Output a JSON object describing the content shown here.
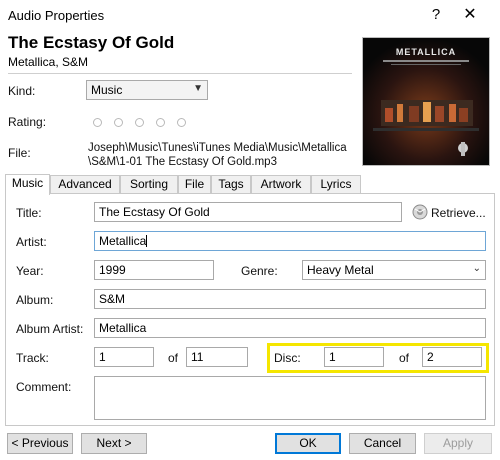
{
  "window": {
    "title": "Audio Properties",
    "help": "?",
    "close": "✕"
  },
  "header": {
    "title": "The Ecstasy Of Gold",
    "subtitle": "Metallica, S&M"
  },
  "artwork": {
    "text": "METALLICA"
  },
  "kind": {
    "label": "Kind:",
    "value": "Music"
  },
  "rating": {
    "label": "Rating:",
    "stars": 0,
    "max": 5
  },
  "file": {
    "label": "File:",
    "path": "Joseph\\Music\\Tunes\\iTunes Media\\Music\\Metallica\\S&M\\1-01 The Ecstasy Of Gold.mp3"
  },
  "tabs": [
    "Music",
    "Advanced",
    "Sorting",
    "File",
    "Tags",
    "Artwork",
    "Lyrics"
  ],
  "active_tab": "Music",
  "form": {
    "title_label": "Title:",
    "title_value": "The Ecstasy Of Gold",
    "retrieve_label": "Retrieve...",
    "artist_label": "Artist:",
    "artist_value": "Metallica",
    "year_label": "Year:",
    "year_value": "1999",
    "genre_label": "Genre:",
    "genre_value": "Heavy Metal",
    "album_label": "Album:",
    "album_value": "S&M",
    "album_artist_label": "Album Artist:",
    "album_artist_value": "Metallica",
    "track_label": "Track:",
    "track_value": "1",
    "of_label": "of",
    "track_total": "11",
    "disc_label": "Disc:",
    "disc_value": "1",
    "disc_total": "2",
    "comment_label": "Comment:",
    "comment_value": ""
  },
  "buttons": {
    "previous": "< Previous",
    "next": "Next >",
    "ok": "OK",
    "cancel": "Cancel",
    "apply": "Apply"
  },
  "colors": {
    "highlight": "#f5e600",
    "focus_border": "#6ea6d6"
  }
}
